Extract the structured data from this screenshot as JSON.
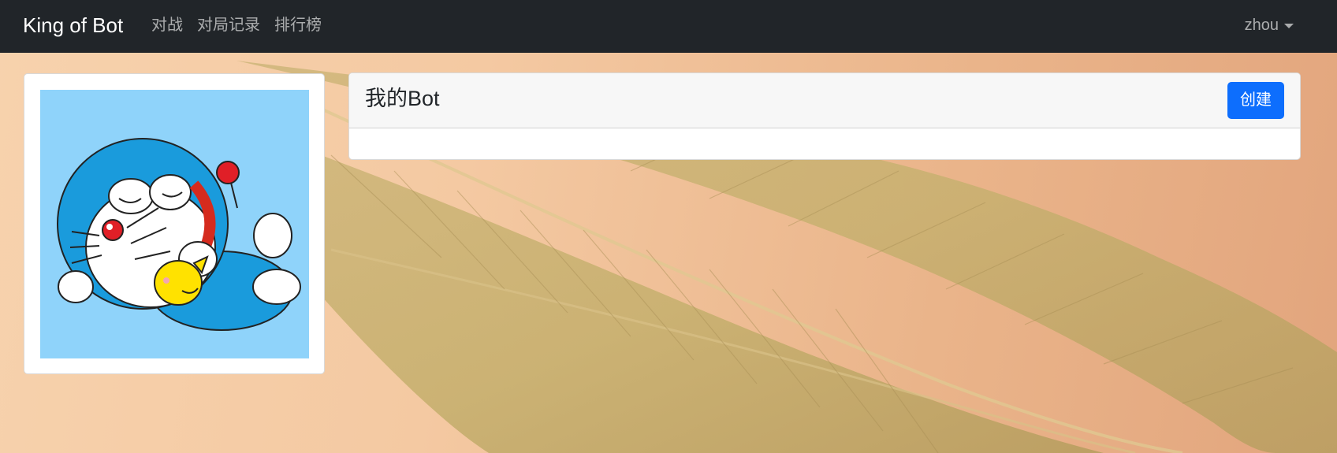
{
  "navbar": {
    "brand": "King of Bot",
    "links": [
      "对战",
      "对局记录",
      "排行榜"
    ],
    "user": "zhou",
    "caret_icon": "caret-down-icon"
  },
  "profile": {
    "avatar_icon": "doraemon-avatar-image"
  },
  "bots": {
    "title": "我的Bot",
    "create_label": "创建"
  },
  "colors": {
    "navbar_bg": "#212529",
    "primary": "#0d6efd",
    "card_header_bg": "#f7f7f7",
    "page_bg": "#f4c9a2"
  }
}
